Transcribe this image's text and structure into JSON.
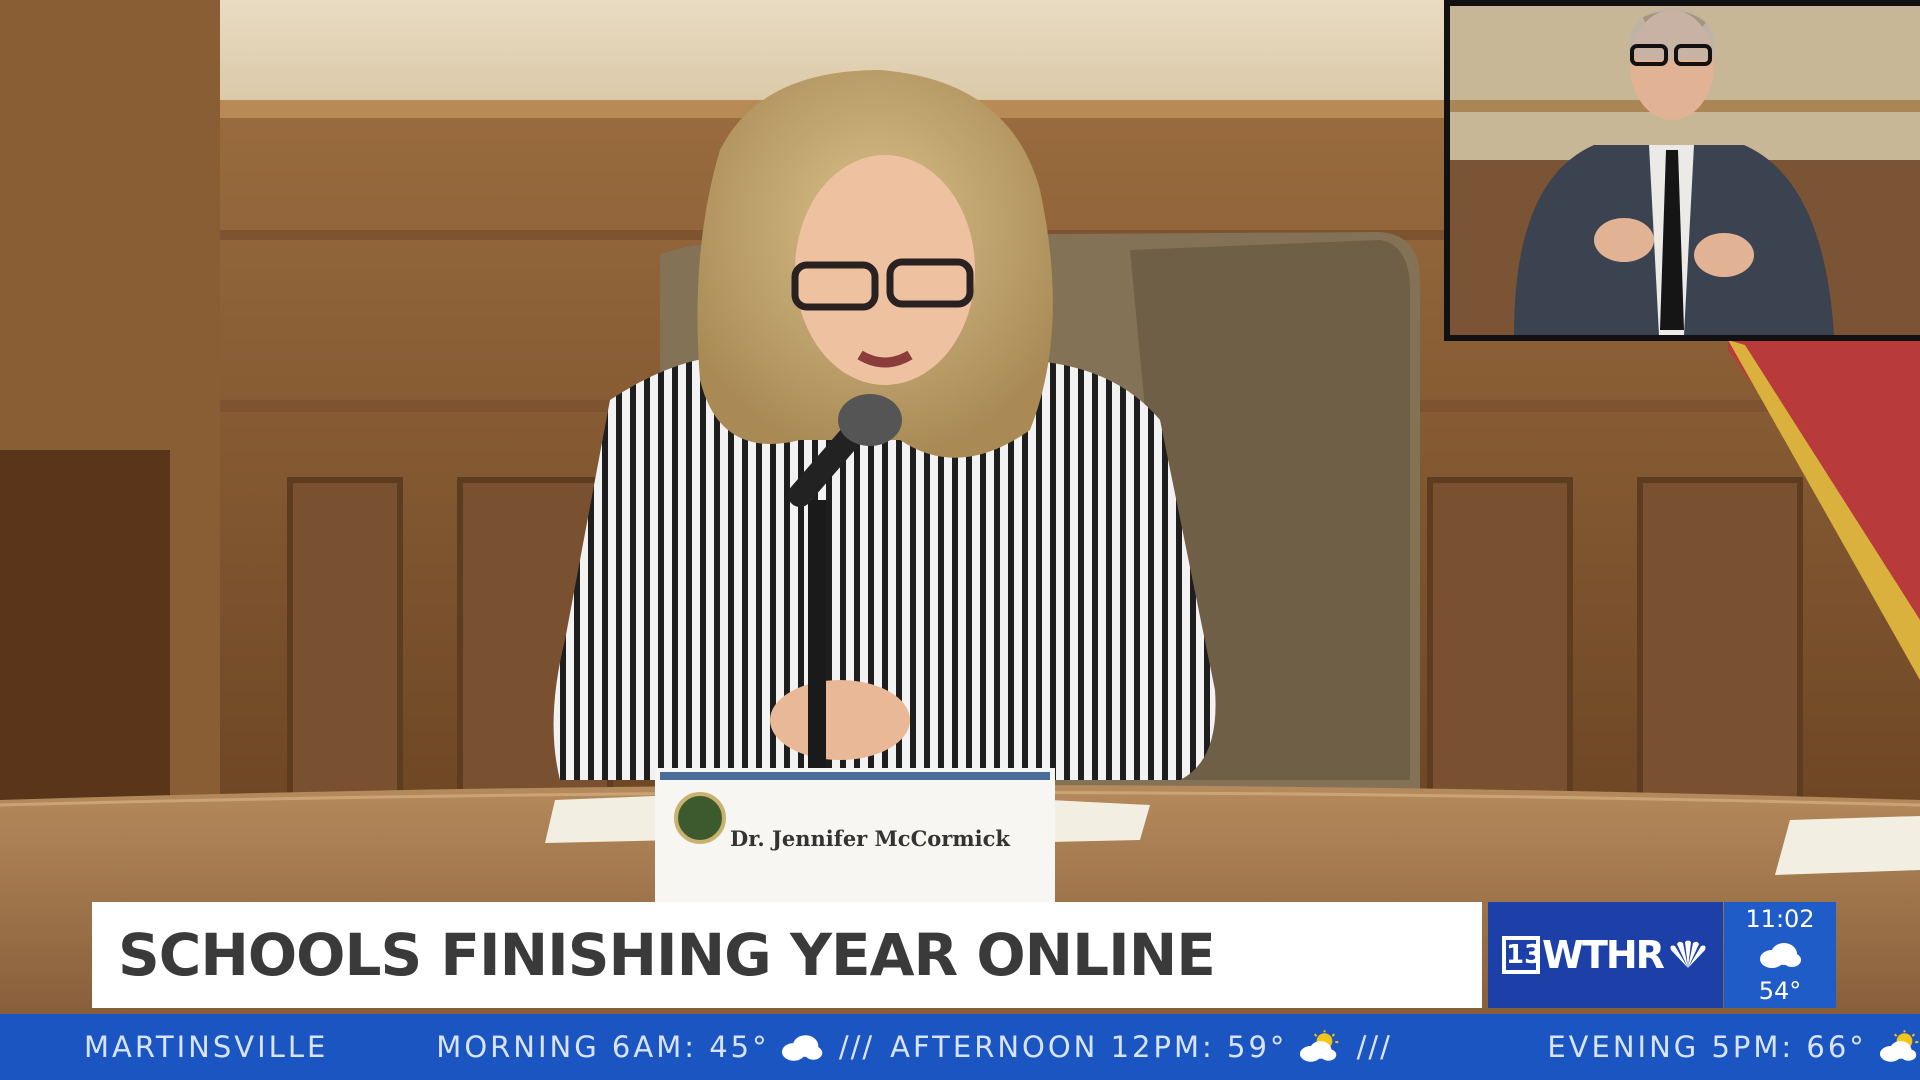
{
  "lower_third": {
    "headline": "SCHOOLS FINISHING YEAR ONLINE"
  },
  "nameplate": {
    "text": "Dr. Jennifer McCormick"
  },
  "station": {
    "channel_number": "13",
    "call_letters": "WTHR",
    "brand_color": "#1c3fa8"
  },
  "weather_now": {
    "time": "11:02",
    "temperature": "54°",
    "icon": "cloud-icon"
  },
  "ticker": {
    "city": "MARTINSVILLE",
    "forecasts": [
      {
        "label": "MORNING 6AM: 45°",
        "icon": "cloud-icon"
      },
      {
        "label": "AFTERNOON 12PM: 59°",
        "icon": "sun-cloud-icon"
      },
      {
        "label": "EVENING 5PM: 66°",
        "icon": "sun-cloud-icon"
      }
    ],
    "separator": "///",
    "color": "#1a55c2"
  }
}
